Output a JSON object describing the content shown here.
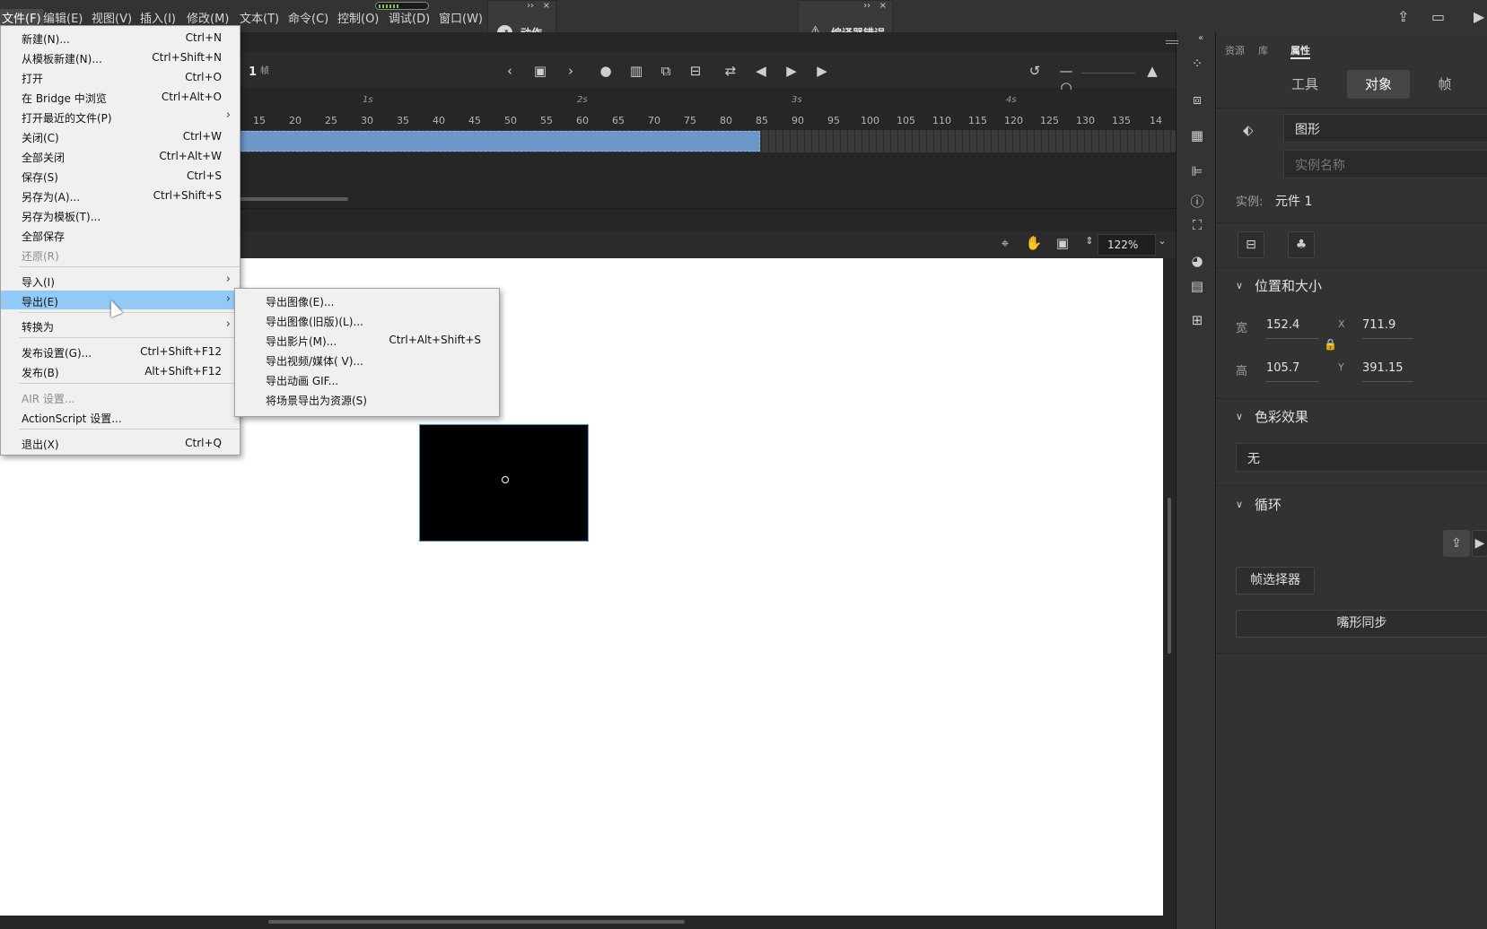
{
  "menubar": {
    "items": [
      "文件(F)",
      "编辑(E)",
      "视图(V)",
      "插入(I)",
      "修改(M)",
      "文本(T)",
      "命令(C)",
      "控制(O)",
      "调试(D)",
      "窗口(W)"
    ]
  },
  "floating_panels": {
    "actions": "动作",
    "compiler_errors": "编译器错误",
    "collapse_glyph": "››",
    "close_glyph": "×"
  },
  "timeline": {
    "current_frame": "1",
    "frame_unit": "帧",
    "seconds": [
      "1s",
      "2s",
      "3s",
      "4s"
    ],
    "frame_numbers": [
      "15",
      "20",
      "25",
      "30",
      "35",
      "40",
      "45",
      "50",
      "55",
      "60",
      "65",
      "70",
      "75",
      "80",
      "85",
      "90",
      "95",
      "100",
      "105",
      "110",
      "115",
      "120",
      "125",
      "130",
      "135",
      "14"
    ]
  },
  "stage": {
    "zoom": "122%"
  },
  "file_menu": {
    "items": [
      {
        "label": "新建(N)...",
        "shortcut": "Ctrl+N"
      },
      {
        "label": "从模板新建(N)...",
        "shortcut": "Ctrl+Shift+N"
      },
      {
        "label": "打开",
        "shortcut": "Ctrl+O"
      },
      {
        "label": "在 Bridge 中浏览",
        "shortcut": "Ctrl+Alt+O"
      },
      {
        "label": "打开最近的文件(P)",
        "shortcut": ""
      },
      {
        "label": "关闭(C)",
        "shortcut": "Ctrl+W"
      },
      {
        "label": "全部关闭",
        "shortcut": "Ctrl+Alt+W"
      },
      {
        "label": "保存(S)",
        "shortcut": "Ctrl+S"
      },
      {
        "label": "另存为(A)...",
        "shortcut": "Ctrl+Shift+S"
      },
      {
        "label": "另存为模板(T)...",
        "shortcut": ""
      },
      {
        "label": "全部保存",
        "shortcut": ""
      },
      {
        "label": "还原(R)",
        "shortcut": ""
      },
      {
        "label": "导入(I)",
        "shortcut": ""
      },
      {
        "label": "导出(E)",
        "shortcut": ""
      },
      {
        "label": "转换为",
        "shortcut": ""
      },
      {
        "label": "发布设置(G)...",
        "shortcut": "Ctrl+Shift+F12"
      },
      {
        "label": "发布(B)",
        "shortcut": "Alt+Shift+F12"
      },
      {
        "label": "AIR 设置...",
        "shortcut": ""
      },
      {
        "label": "ActionScript 设置...",
        "shortcut": ""
      },
      {
        "label": "退出(X)",
        "shortcut": "Ctrl+Q"
      }
    ],
    "submenu_arrow": "›"
  },
  "export_submenu": {
    "items": [
      {
        "label": "导出图像(E)...",
        "shortcut": ""
      },
      {
        "label": "导出图像(旧版)(L)...",
        "shortcut": ""
      },
      {
        "label": "导出影片(M)...",
        "shortcut": "Ctrl+Alt+Shift+S"
      },
      {
        "label": "导出视频/媒体( V)...",
        "shortcut": ""
      },
      {
        "label": "导出动画 GIF...",
        "shortcut": ""
      },
      {
        "label": "将场景导出为资源(S)",
        "shortcut": ""
      }
    ]
  },
  "properties": {
    "tabs": [
      "资源",
      "库",
      "属性"
    ],
    "segments": [
      "工具",
      "对象",
      "帧"
    ],
    "symbol_type": "图形",
    "instance_name_placeholder": "实例名称",
    "instance_label": "实例:",
    "instance_value": "元件 1",
    "position_size": {
      "title": "位置和大小",
      "w_label": "宽",
      "w": "152.4",
      "h_label": "高",
      "h": "105.7",
      "x_label": "X",
      "x": "711.9",
      "y_label": "Y",
      "y": "391.15"
    },
    "color_effect": {
      "title": "色彩效果",
      "value": "无"
    },
    "loop": {
      "title": "循环",
      "frame_picker": "帧选择器",
      "lip_sync": "嘴形同步"
    }
  },
  "colors": {
    "accent_blue": "#6b97c9",
    "menu_highlight": "#91c9f7"
  }
}
